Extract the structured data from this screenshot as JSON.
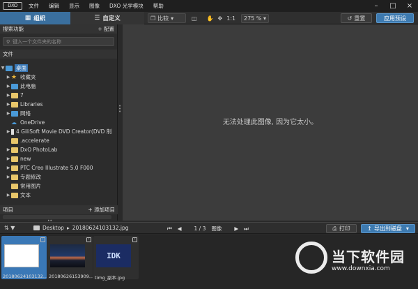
{
  "titlebar": {
    "logo": "DXO",
    "menu": [
      "文件",
      "编辑",
      "显示",
      "图像",
      "DXO 光学模块",
      "帮助"
    ]
  },
  "toolbar": {
    "tab_organize": "组织",
    "tab_customize": "自定义",
    "compare_label": "比较",
    "ratio_label": "1:1",
    "zoom_value": "275 %",
    "reset_label": "重置",
    "apply_preset_label": "应用预设"
  },
  "left": {
    "search_title": "搜索功能",
    "configure_label": "+ 配置",
    "search_placeholder": "键入一个文件夹的名称",
    "files_title": "文件",
    "tree": [
      {
        "label": "桌面",
        "selected": true,
        "level": 0
      },
      {
        "label": "收藏夹",
        "level": 1
      },
      {
        "label": "此电脑",
        "level": 1
      },
      {
        "label": "7",
        "level": 1
      },
      {
        "label": "Libraries",
        "level": 1
      },
      {
        "label": "网络",
        "level": 1
      },
      {
        "label": "OneDrive",
        "level": 1
      },
      {
        "label": "4 GiliSoft Movie DVD Creator(DVD 制",
        "level": 1
      },
      {
        "label": ".accelerate",
        "level": 1
      },
      {
        "label": "DxO PhotoLab",
        "level": 1
      },
      {
        "label": "new",
        "level": 1
      },
      {
        "label": "PTC Creo Illustrate 5.0 F000",
        "level": 1
      },
      {
        "label": "专题修改",
        "level": 1
      },
      {
        "label": "常用图片",
        "level": 1
      },
      {
        "label": "文本",
        "level": 1
      }
    ],
    "projects_title": "项目",
    "add_project_label": "+ 添加项目"
  },
  "main": {
    "message": "无法处理此图像, 因为它太小。"
  },
  "filmbar": {
    "folder": "Desktop",
    "file": "20180624103132.jpg",
    "counter": "1 / 3",
    "counter_unit": "图像",
    "print_label": "打印",
    "export_label": "导出到磁盘"
  },
  "filmstrip": [
    {
      "caption": "20180624103132...."
    },
    {
      "caption": "20180626153909...."
    },
    {
      "caption": "timg_副本.jpg",
      "thumb_text": "IDK"
    }
  ],
  "watermark": {
    "name": "当下软件园",
    "url": "www.downxia.com"
  }
}
